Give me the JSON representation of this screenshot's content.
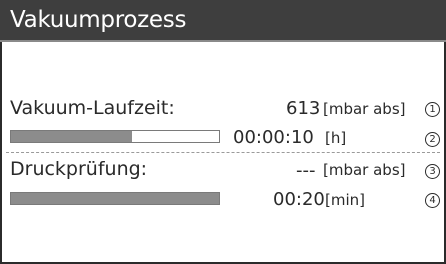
{
  "window": {
    "title": "Vakuumprozess"
  },
  "vacuum": {
    "label": "Vakuum-Laufzeit:",
    "value": "613",
    "unit": "[mbar abs]",
    "marker": "1",
    "progress_fraction": 0.58,
    "time": "00:00:10",
    "time_unit": "[h]",
    "time_marker": "2"
  },
  "pressure_test": {
    "label": "Druckprüfung:",
    "value": "---",
    "unit": "[mbar abs]",
    "marker": "3",
    "progress_fraction": 1.0,
    "time": "00:20",
    "time_unit": "[min]",
    "time_marker": "4"
  },
  "colors": {
    "title_bg": "#3e3e3e",
    "bar_fill": "#8c8c8c",
    "text": "#2a2a2a"
  }
}
